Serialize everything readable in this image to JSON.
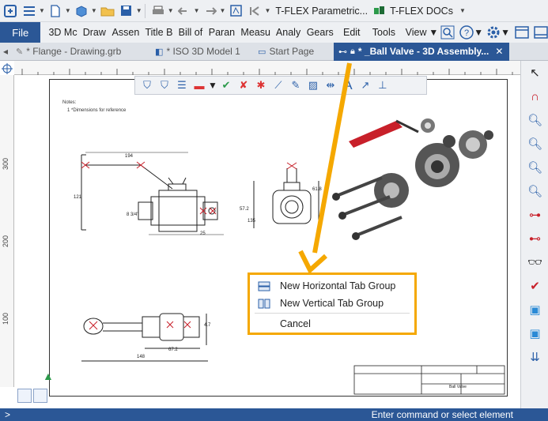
{
  "app": {
    "title": "T-FLEX Parametric...",
    "docs_button": "T-FLEX DOCs"
  },
  "menu": {
    "file": "File",
    "items": [
      "3D Mc",
      "Draw",
      "Assen",
      "Title B",
      "Bill of",
      "Paran",
      "Measu",
      "Analy",
      "Gears",
      "Edit",
      "Tools",
      "View"
    ]
  },
  "tabs": [
    {
      "label": "* Flange - Drawing.grb",
      "active": false
    },
    {
      "label": "* ISO 3D Model 1",
      "active": false
    },
    {
      "label": "Start Page",
      "active": false
    },
    {
      "label": "* _Ball Valve - 3D Assembly...",
      "active": true
    }
  ],
  "ruler": {
    "left_labels": [
      "300",
      "200",
      "100"
    ]
  },
  "drawing": {
    "notes_title": "Notes:",
    "notes_line": "1 *Dimensions for reference",
    "dims": [
      "194",
      "121",
      "8 3/4\"",
      "25",
      "61.8",
      "57.2",
      "135",
      "67.2",
      "148",
      "4.7"
    ],
    "title_block": "Ball Valve"
  },
  "context_menu": {
    "items": [
      {
        "label": "New Horizontal Tab Group",
        "icon": "horizontal-split-icon"
      },
      {
        "label": "New Vertical Tab Group",
        "icon": "vertical-split-icon"
      },
      {
        "label": "Cancel",
        "icon": ""
      }
    ]
  },
  "status": {
    "prompt": ">",
    "message": "Enter command or select element"
  },
  "colors": {
    "accent": "#2b5796",
    "highlight": "#f5a800",
    "handle": "#c8202a"
  }
}
